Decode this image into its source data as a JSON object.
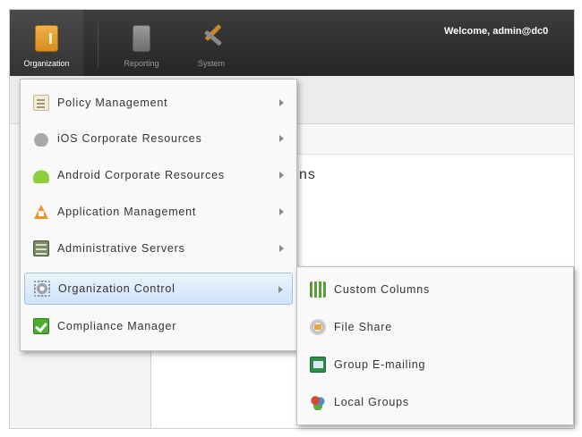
{
  "topbar": {
    "organization_label": "Organization",
    "reporting_label": "Reporting",
    "system_label": "System",
    "welcome_text": "Welcome, admin@dc0"
  },
  "main": {
    "title_fragment": "ns"
  },
  "menu": {
    "items": [
      {
        "label": "Policy Management",
        "icon": "policy-document-icon",
        "has_submenu": true
      },
      {
        "label": "iOS Corporate Resources",
        "icon": "apple-icon",
        "has_submenu": true
      },
      {
        "label": "Android Corporate Resources",
        "icon": "android-icon",
        "has_submenu": true
      },
      {
        "label": "Application Management",
        "icon": "app-store-icon",
        "has_submenu": true
      },
      {
        "label": "Administrative Servers",
        "icon": "servers-icon",
        "has_submenu": true
      },
      {
        "label": "Organization Control",
        "icon": "gear-icon",
        "has_submenu": true,
        "highlighted": true
      },
      {
        "label": "Compliance Manager",
        "icon": "checkmark-icon",
        "has_submenu": false
      }
    ]
  },
  "submenu": {
    "items": [
      {
        "label": "Custom Columns",
        "icon": "columns-icon"
      },
      {
        "label": "File Share",
        "icon": "file-share-icon"
      },
      {
        "label": "Group E-mailing",
        "icon": "mail-icon"
      },
      {
        "label": "Local Groups",
        "icon": "groups-icon"
      }
    ]
  },
  "colors": {
    "topbar_bg": "#2e2e2e",
    "highlight_bg": "#cfe3f8",
    "highlight_border": "#9cc3ea"
  }
}
